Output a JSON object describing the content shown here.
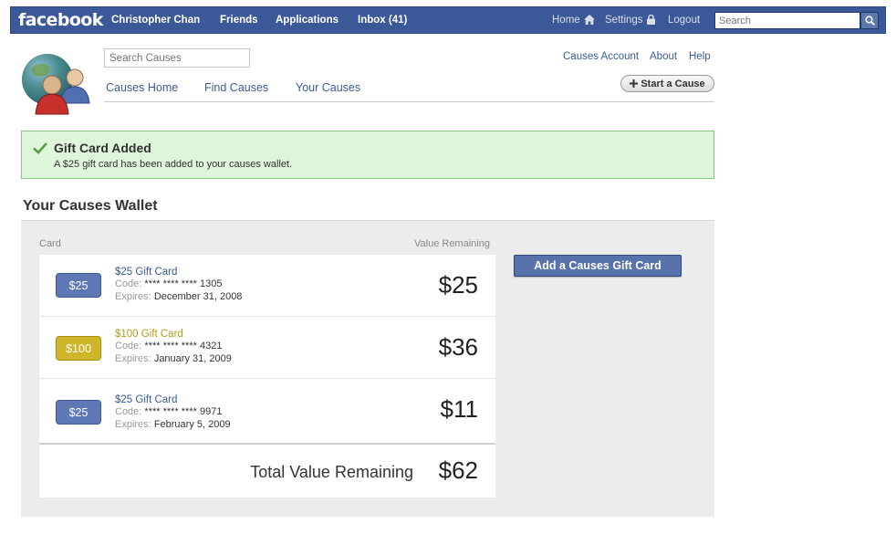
{
  "topbar": {
    "logo": "facebook",
    "user": "Christopher Chan",
    "friends": "Friends",
    "applications": "Applications",
    "inbox": "Inbox (41)",
    "home": "Home",
    "settings": "Settings",
    "logout": "Logout",
    "search_placeholder": "Search",
    "brand_color": "#3b5998"
  },
  "causes": {
    "search_placeholder": "Search Causes",
    "tabs": [
      "Causes Home",
      "Find Causes",
      "Your Causes"
    ],
    "links": [
      "Causes Account",
      "About",
      "Help"
    ],
    "start_cause": "Start a Cause"
  },
  "notice": {
    "title": "Gift Card Added",
    "body": "A $25 gift card has been added to your causes wallet.",
    "color": "#ddf5d9"
  },
  "wallet": {
    "title": "Your Causes Wallet",
    "col_card": "Card",
    "col_value": "Value Remaining",
    "add_button": "Add a Causes Gift Card",
    "code_label": "Code:",
    "expires_label": "Expires:",
    "cards": [
      {
        "badge": "$25",
        "name": "$25 Gift Card",
        "code": "**** **** **** 1305",
        "expires": "December 31, 2008",
        "value": "$25",
        "color": "blue"
      },
      {
        "badge": "$100",
        "name": "$100 Gift Card",
        "code": "**** **** **** 4321",
        "expires": "January 31, 2009",
        "value": "$36",
        "color": "gold"
      },
      {
        "badge": "$25",
        "name": "$25 Gift Card",
        "code": "**** **** **** 9971",
        "expires": "February 5, 2009",
        "value": "$11",
        "color": "blue"
      }
    ],
    "total_label": "Total Value Remaining",
    "total_value": "$62"
  }
}
